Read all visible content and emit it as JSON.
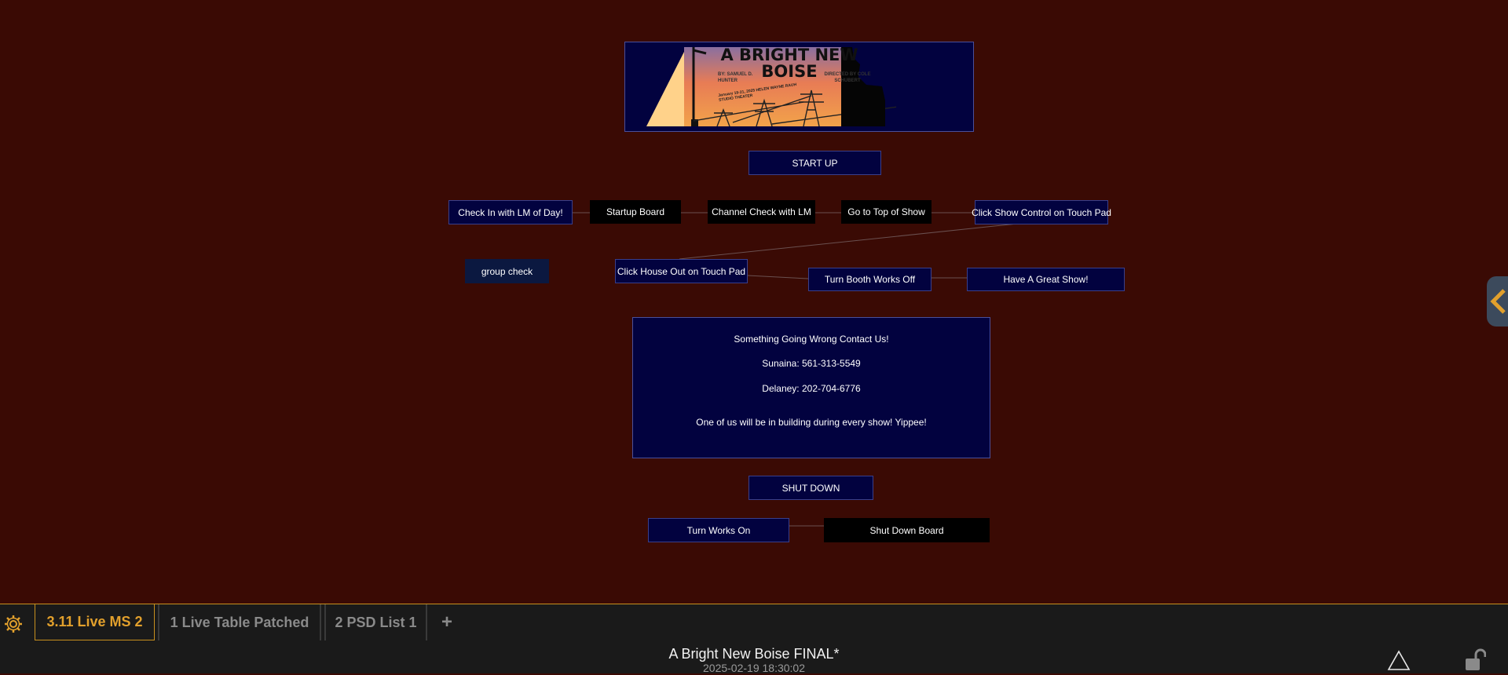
{
  "banner": {
    "title": "A BRIGHT NEW BOISE",
    "byline": "BY: SAMUEL D. HUNTER",
    "director": "DIRECTED BY COLE SCHUBERT",
    "dates": "January 19-21, 2025 HELEN WAYNE RAUH STUDIO THEATER"
  },
  "nodes": {
    "start_up": "START UP",
    "check_in": "Check In with LM of Day!",
    "startup_board": "Startup Board",
    "channel_check": "Channel Check with LM",
    "top_of_show": "Go to Top of Show",
    "show_control": "Click Show Control on Touch Pad",
    "group_check": "group check",
    "house_out": "Click House Out on Touch Pad",
    "booth_works_off": "Turn Booth Works Off",
    "great_show": "Have A Great Show!",
    "shut_down": "SHUT DOWN",
    "works_on": "Turn Works On",
    "shut_down_board": "Shut Down Board"
  },
  "info": {
    "heading": "Something Going Wrong Contact Us!",
    "contact1": "Sunaina: 561-313-5549",
    "contact2": "Delaney: 202-704-6776",
    "note": "One of us will be in building during every show! Yippee!"
  },
  "tabs": [
    {
      "label": "3.11 Live MS 2",
      "active": true
    },
    {
      "label": "1 Live Table Patched",
      "active": false
    },
    {
      "label": "2 PSD List 1",
      "active": false
    }
  ],
  "add_tab": "+",
  "status": {
    "show_title": "A Bright New Boise FINAL*",
    "timestamp": "2025-02-19 18:30:02"
  },
  "icons": {
    "settings": "gear-icon",
    "warning": "warning-triangle-icon",
    "lock": "unlock-icon",
    "side_panel": "chevron-left-icon"
  },
  "colors": {
    "background": "#3a0a04",
    "node_navy": "#02023f",
    "accent": "#e2a02c"
  }
}
